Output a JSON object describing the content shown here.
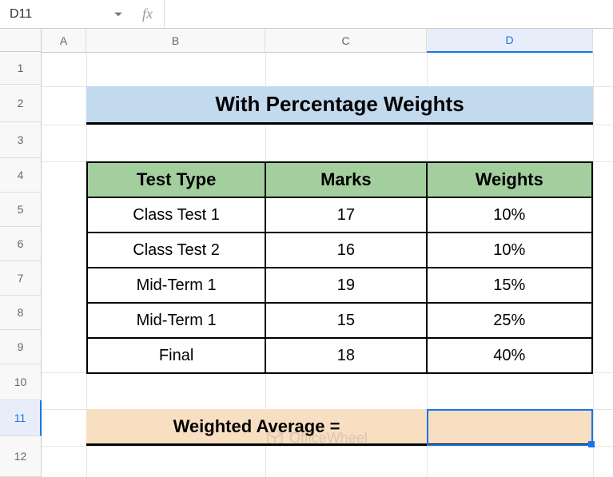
{
  "name_box": "D11",
  "fx_label": "fx",
  "formula_value": "",
  "columns": [
    "A",
    "B",
    "C",
    "D"
  ],
  "rows": [
    "1",
    "2",
    "3",
    "4",
    "5",
    "6",
    "7",
    "8",
    "9",
    "10",
    "11",
    "12"
  ],
  "title": "With Percentage Weights",
  "table": {
    "headers": [
      "Test Type",
      "Marks",
      "Weights"
    ],
    "rows": [
      [
        "Class Test 1",
        "17",
        "10%"
      ],
      [
        "Class Test 2",
        "16",
        "10%"
      ],
      [
        "Mid-Term 1",
        "19",
        "15%"
      ],
      [
        "Mid-Term 1",
        "15",
        "25%"
      ],
      [
        "Final",
        "18",
        "40%"
      ]
    ]
  },
  "weighted_average_label": "Weighted Average =",
  "weighted_average_value": "",
  "watermark": "OfficeWheel",
  "selected_cell": "D11"
}
